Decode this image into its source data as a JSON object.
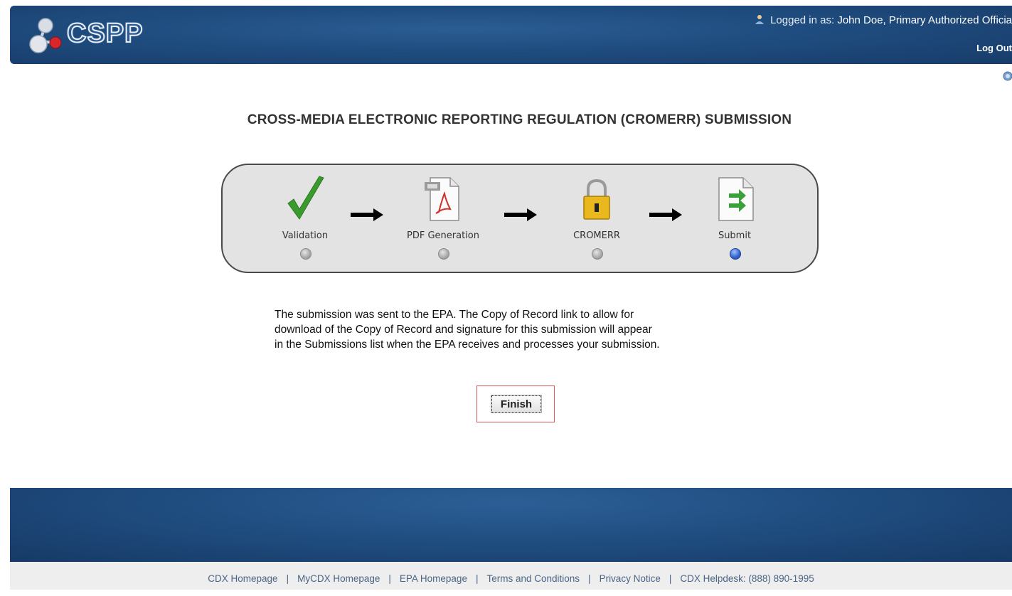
{
  "header": {
    "logo_text": "CSPP",
    "logged_in_prefix": "Logged in as:",
    "logged_in_user": "John Doe, Primary Authorized Officia",
    "logout_label": "Log Out"
  },
  "main": {
    "title": "CROSS-MEDIA ELECTRONIC REPORTING REGULATION (CROMERR) SUBMISSION",
    "steps": [
      {
        "label": "Validation",
        "icon": "checkmark-icon",
        "active": false
      },
      {
        "label": "PDF Generation",
        "icon": "pdf-icon",
        "active": false
      },
      {
        "label": "CROMERR",
        "icon": "lock-icon",
        "active": false
      },
      {
        "label": "Submit",
        "icon": "submit-document-icon",
        "active": true
      }
    ],
    "message_line1": "The submission was sent to the EPA. The Copy of Record link to allow for",
    "message_line2": "download of the Copy of Record and signature for this submission will appear",
    "message_line3": "in the Submissions list when the EPA receives and processes your submission.",
    "finish_label": "Finish"
  },
  "footer": {
    "links": [
      "CDX Homepage",
      "MyCDX Homepage",
      "EPA Homepage",
      "Terms and Conditions",
      "Privacy Notice",
      "CDX Helpdesk: (888) 890-1995"
    ]
  },
  "colors": {
    "header_blue": "#1f4c7f",
    "active_step": "#3568d4",
    "check_green": "#3a9a2e",
    "finish_highlight": "#d65a5a"
  }
}
